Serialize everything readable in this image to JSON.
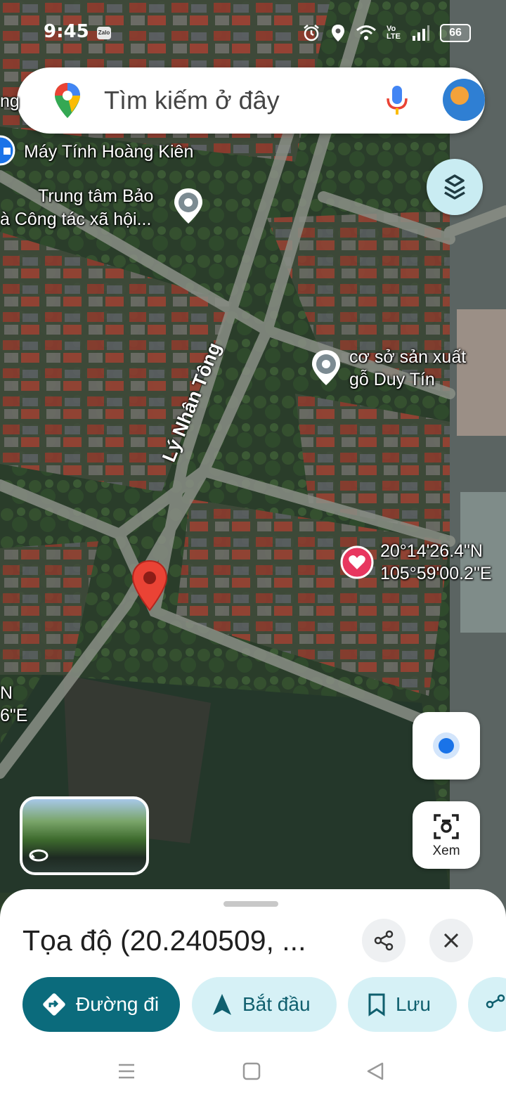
{
  "status_bar": {
    "time": "9:45",
    "app_badge": "Zalo",
    "network": "Vo LTE",
    "battery": "66"
  },
  "search": {
    "placeholder": "Tìm kiếm ở đây"
  },
  "map": {
    "places": [
      {
        "id": "may-tinh",
        "name": "Máy Tính Hoàng Kiên"
      },
      {
        "id": "trung-tam-line1",
        "name": "Trung tâm Bảo"
      },
      {
        "id": "trung-tam-line2",
        "name": "à Công tác xã hội..."
      },
      {
        "id": "co-so-line1",
        "name": "cơ sở sản xuất"
      },
      {
        "id": "co-so-line2",
        "name": "gỗ Duy Tín"
      },
      {
        "id": "saved-lat",
        "name": "20°14'26.4\"N"
      },
      {
        "id": "saved-lng",
        "name": "105°59'00.2\"E"
      }
    ],
    "street": "Lý Nhân Tông",
    "edge_label_top": "ng",
    "edge_label_bottom_1": "N",
    "edge_label_bottom_2": "6\"E"
  },
  "controls": {
    "view_label": "Xem"
  },
  "sheet": {
    "title": "Tọa độ (20.240509, ...",
    "chips": [
      {
        "label": "Đường đi",
        "icon": "directions-icon"
      },
      {
        "label": "Bắt đầu",
        "icon": "navigation-arrow-icon"
      },
      {
        "label": "Lưu",
        "icon": "bookmark-icon"
      }
    ]
  },
  "colors": {
    "primary": "#0b6b7c",
    "chip_bg": "#d6f1f6",
    "pin_red": "#ea4335",
    "saved_pink": "#e8375f"
  }
}
